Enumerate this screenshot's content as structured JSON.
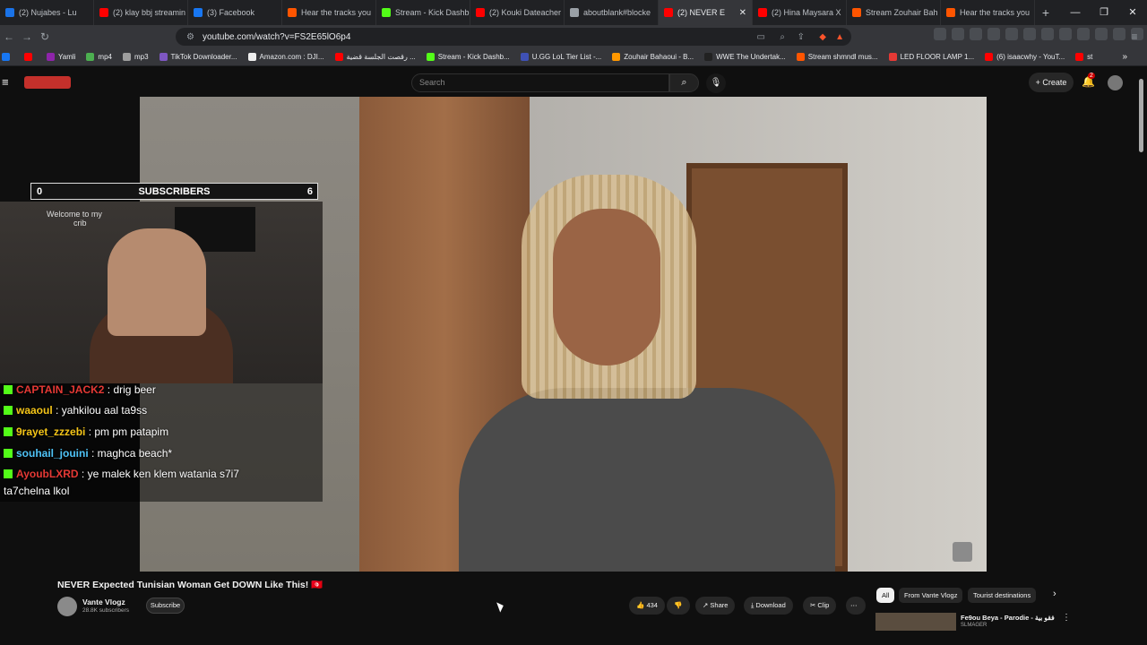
{
  "tabs": [
    {
      "label": "(2) Nujabes - Lu",
      "color": "#1a73e8"
    },
    {
      "label": "(2) klay bbj streamin",
      "color": "#ff0000"
    },
    {
      "label": "(3) Facebook",
      "color": "#1877f2"
    },
    {
      "label": "Hear the tracks you",
      "color": "#ff5500"
    },
    {
      "label": "Stream - Kick Dashb",
      "color": "#53fc18"
    },
    {
      "label": "(2) Kouki Dateacher",
      "color": "#ff0000"
    },
    {
      "label": "aboutblank#blocke",
      "color": "#9aa0a6"
    },
    {
      "label": "(2) NEVER E",
      "color": "#ff0000",
      "active": true
    },
    {
      "label": "(2) Hina Maysara X",
      "color": "#ff0000"
    },
    {
      "label": "Stream Zouhair Bah",
      "color": "#ff5500"
    },
    {
      "label": "Hear the tracks you",
      "color": "#ff5500"
    }
  ],
  "address": {
    "url": "youtube.com/watch?v=FS2E65lO6p4"
  },
  "bookmarks": [
    {
      "label": "",
      "color": "#1877f2"
    },
    {
      "label": "",
      "color": "#ff0000"
    },
    {
      "label": "Yamli",
      "color": "#8e24aa"
    },
    {
      "label": "mp4",
      "color": "#4caf50"
    },
    {
      "label": "mp3",
      "color": "#9e9e9e"
    },
    {
      "label": "TikTok Downloader...",
      "color": "#7e57c2"
    },
    {
      "label": "Amazon.com : DJI...",
      "color": "#eeeeee"
    },
    {
      "label": "رقصت الجلسة قضية ...",
      "color": "#ff0000"
    },
    {
      "label": "Stream - Kick Dashb...",
      "color": "#53fc18"
    },
    {
      "label": "U.GG LoL Tier List -...",
      "color": "#3f51b5"
    },
    {
      "label": "Zouhair Bahaoui - B...",
      "color": "#ff9800"
    },
    {
      "label": "WWE The Undertak...",
      "color": "#222222"
    },
    {
      "label": "Stream shmndl mus...",
      "color": "#ff5500"
    },
    {
      "label": "LED FLOOR LAMP 1...",
      "color": "#e53935"
    },
    {
      "label": "(6) isaacwhy - YouT...",
      "color": "#ff0000"
    },
    {
      "label": "st",
      "color": "#ff0000"
    }
  ],
  "yt": {
    "search_placeholder": "Search",
    "create_label": "Create",
    "notif_count": "2"
  },
  "overlay": {
    "sub_left": "0",
    "sub_title": "SUBSCRIBERS",
    "sub_right": "6",
    "welcome_line1": "Welcome to my",
    "welcome_line2": "crib"
  },
  "chat": [
    {
      "user": "CAPTAIN_JACK2",
      "text": " : drig beer",
      "color": "#e53935",
      "badge": "#53fc18"
    },
    {
      "user": "waaoul",
      "text": " : yahkilou aal ta9ss",
      "color": "#f5c518",
      "badge": "#53fc18"
    },
    {
      "user": "9rayet_zzzebi",
      "text": " : pm pm patapim",
      "color": "#f5c518",
      "badge": "#53fc18"
    },
    {
      "user": "souhail_jouini",
      "text": " : maghca beach*",
      "color": "#4fc3f7",
      "badge": "#53fc18"
    },
    {
      "user": "AyoubLXRD",
      "text": " : ye malek ken klem watania s7i7",
      "color": "#e53935",
      "badge": "#53fc18"
    }
  ],
  "chat_continuation": "ta7chelna lkol",
  "video": {
    "title": "NEVER Expected Tunisian Woman Get DOWN Like This! 🇹🇳",
    "channel": "Vante Vlogz",
    "subscribers": "28.8K subscribers",
    "subscribe_label": "Subscribe",
    "likes": "434",
    "share_label": "Share",
    "download_label": "Download",
    "clip_label": "Clip"
  },
  "chips": [
    "All",
    "From Vante Vlogz",
    "Tourist destinations"
  ],
  "recommendation": {
    "title": "Fe9ou Beya - Parodie - فقو بية",
    "channel": "SLMAGER"
  }
}
